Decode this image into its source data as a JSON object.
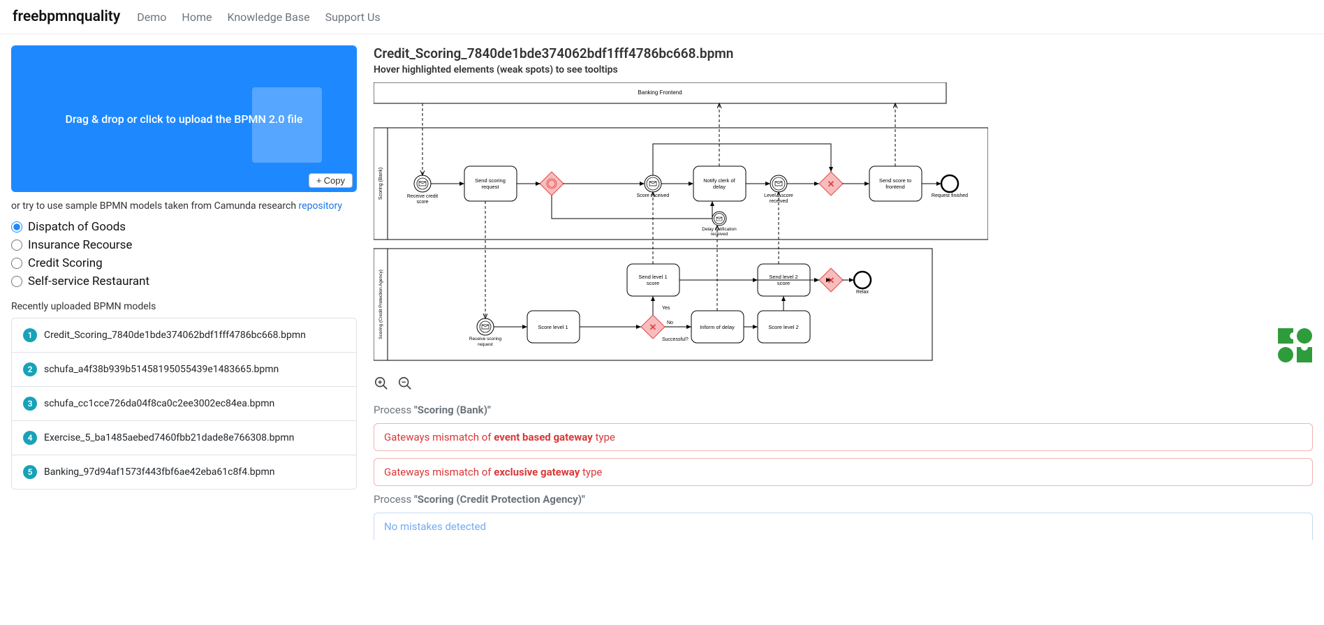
{
  "navbar": {
    "brand": "freebpmnquality",
    "links": [
      "Demo",
      "Home",
      "Knowledge Base",
      "Support Us"
    ]
  },
  "dropzone": {
    "text": "Drag & drop or click to upload the BPMN 2.0 file",
    "copy_label": "Copy"
  },
  "subtext": {
    "prefix": "or try to use sample BPMN models taken from Camunda research ",
    "link": "repository"
  },
  "samples": [
    {
      "label": "Dispatch of Goods",
      "checked": true
    },
    {
      "label": "Insurance Recourse",
      "checked": false
    },
    {
      "label": "Credit Scoring",
      "checked": false
    },
    {
      "label": "Self-service Restaurant",
      "checked": false
    }
  ],
  "recent_heading": "Recently uploaded BPMN models",
  "recent": [
    {
      "num": "1",
      "name": "Credit_Scoring_7840de1bde374062bdf1fff4786bc668.bpmn"
    },
    {
      "num": "2",
      "name": "schufa_a4f38b939b51458195055439e1483665.bpmn"
    },
    {
      "num": "3",
      "name": "schufa_cc1cce726da04f8ca0c2ee3002ec84ea.bpmn"
    },
    {
      "num": "4",
      "name": "Exercise_5_ba1485aebed7460fbb21dade8e766308.bpmn"
    },
    {
      "num": "5",
      "name": "Banking_97d94af1573f443fbf6ae42eba61c8f4.bpmn"
    }
  ],
  "file_title": "Credit_Scoring_7840de1bde374062bdf1fff4786bc668.bpmn",
  "hover_hint": "Hover highlighted elements (weak spots) to see tooltips",
  "diagram": {
    "participants": [
      "Banking Frontend",
      "Scoring (Bank)",
      "Scoring (Credit Protection Agency)"
    ],
    "lane1_elements": {
      "start": "Receive credit score",
      "task1": "Send scoring request",
      "catch_score": "Score received",
      "task2": "Notify clerk of delay",
      "catch_l1": "Level 1 score received",
      "catch_delay": "Delay notification received",
      "task3": "Send score to frontend",
      "end": "Request finished"
    },
    "lane2_elements": {
      "start2": "Receive scoring request",
      "taskA": "Score level 1",
      "gw_labels": {
        "yes": "Yes",
        "no": "No",
        "q": "Successful?"
      },
      "taskB": "Send level 1 score",
      "taskC": "Inform of delay",
      "taskD": "Score level 2",
      "taskE": "Send level 2 score",
      "end2": "Relax"
    }
  },
  "results": {
    "process1_heading_prefix": "Process ",
    "process1_heading_name": "\"Scoring (Bank)\"",
    "alerts1": [
      {
        "pre": "Gateways mismatch of ",
        "strong": "event based gateway",
        "post": " type"
      },
      {
        "pre": "Gateways mismatch of ",
        "strong": "exclusive gateway",
        "post": " type"
      }
    ],
    "process2_heading_prefix": "Process ",
    "process2_heading_name": "\"Scoring (Credit Protection Agency)\"",
    "alerts2_text": "No mistakes detected"
  }
}
